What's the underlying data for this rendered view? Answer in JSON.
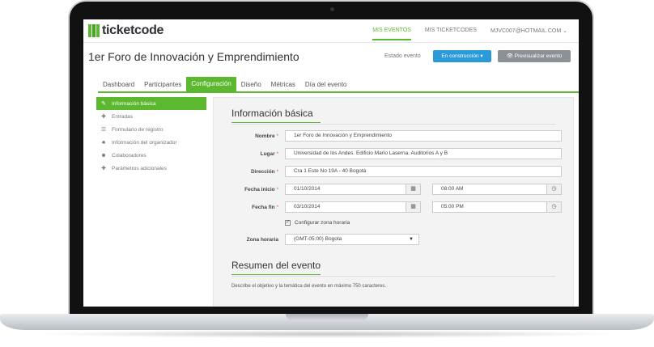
{
  "header": {
    "logo_ticket": "ticket",
    "logo_code": "code",
    "nav": [
      {
        "label": "MIS EVENTOS"
      },
      {
        "label": "MIS TICKETCODES"
      },
      {
        "label": "MJVC007@HOTMAIL.COM ⌄"
      }
    ]
  },
  "event": {
    "title": "1er Foro de Innovación y Emprendimiento",
    "estado_label": "Estado evento",
    "estado_value": "En construcción ▾",
    "preview_label": "Previsualizar evento"
  },
  "tabs": [
    {
      "label": "Dashboard"
    },
    {
      "label": "Participantes"
    },
    {
      "label": "Configuración"
    },
    {
      "label": "Diseño"
    },
    {
      "label": "Métricas"
    },
    {
      "label": "Día del evento"
    }
  ],
  "sidebar": {
    "items": [
      {
        "label": "Información básica",
        "icon": "✎"
      },
      {
        "label": "Entradas",
        "icon": "✚"
      },
      {
        "label": "Formulario de registro",
        "icon": "☰"
      },
      {
        "label": "Información del organizador",
        "icon": "♣"
      },
      {
        "label": "Colaboradores",
        "icon": "☻"
      },
      {
        "label": "Parámetros adicionales",
        "icon": "✚"
      }
    ]
  },
  "form": {
    "section_title": "Información básica",
    "nombre_label": "Nombre",
    "nombre_value": "1er Foro de Innovación y Emprendimiento",
    "lugar_label": "Lugar",
    "lugar_value": "Universidad de los Andes. Edificio Mario Laserna. Auditorios A y B",
    "direccion_label": "Dirección",
    "direccion_value": "Cra 1 Este No 19A - 40 Bogotá",
    "fecha_inicio_label": "Fecha inicio",
    "fecha_inicio_value": "01/10/2014",
    "hora_inicio_value": "08:00 AM",
    "fecha_fin_label": "Fecha fin",
    "fecha_fin_value": "03/10/2014",
    "hora_fin_value": "05:00 PM",
    "zona_checkbox_label": "Configurar zona horaria",
    "zona_label": "Zona horaria",
    "zona_value": "(GMT-05:00) Bogota",
    "required_mark": "*"
  },
  "resumen": {
    "section_title": "Resumen del evento",
    "description": "Describe el objetivo y la temática del evento en máximo 750 caracteres."
  },
  "colors": {
    "accent": "#5cb82e",
    "primary_button": "#2b9ad8",
    "secondary_button": "#8c9196"
  }
}
